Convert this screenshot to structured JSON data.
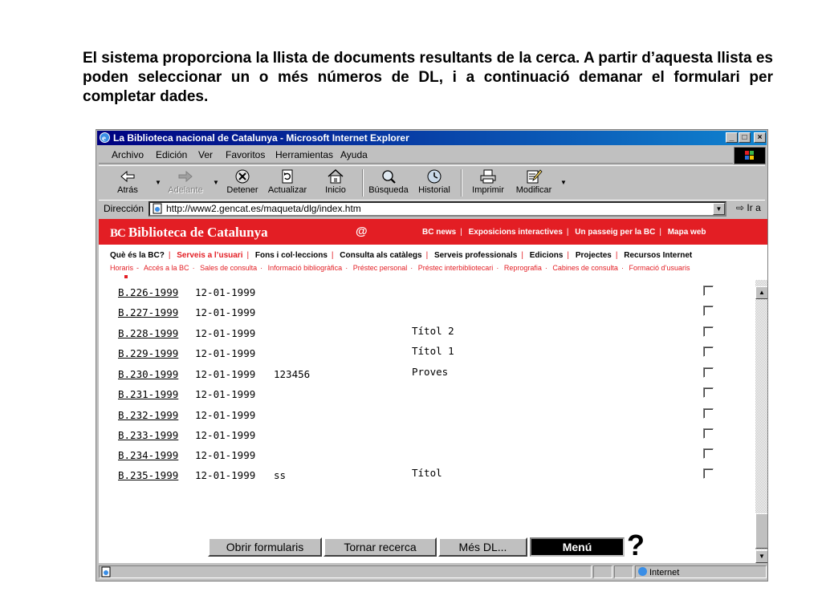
{
  "intro_text": "El sistema proporciona la llista de documents resultants de la cerca. A partir d’aquesta llista es poden seleccionar un o més números de DL, i a continuació demanar el formulari per completar dades.",
  "window": {
    "title": "La Biblioteca nacional de Catalunya - Microsoft Internet Explorer",
    "controls": [
      "_",
      "□",
      "×"
    ]
  },
  "menubar": [
    {
      "label": "Archivo"
    },
    {
      "label": "Edición"
    },
    {
      "label": "Ver"
    },
    {
      "label": "Favoritos"
    },
    {
      "label": "Herramientas"
    },
    {
      "label": "Ayuda"
    }
  ],
  "toolbar": {
    "back": "Atrás",
    "forward": "Adelante",
    "stop": "Detener",
    "refresh": "Actualizar",
    "home": "Inicio",
    "search": "Búsqueda",
    "history": "Historial",
    "print": "Imprimir",
    "edit": "Modificar"
  },
  "address": {
    "label": "Dirección",
    "url": "http://www2.gencat.es/maqueta/dlg/index.htm",
    "go": "Ir a"
  },
  "site": {
    "logo": "Biblioteca de Catalunya",
    "logo_mark": "BC",
    "at_symbol": "@",
    "top_links": [
      "BC news",
      "Exposicions interactives",
      "Un passeig per la BC",
      "Mapa web"
    ],
    "separator": "|",
    "nav": [
      "Què és la BC?",
      "Serveis a l’usuari",
      "Fons i col·leccions",
      "Consulta als catàlegs",
      "Serveis professionals",
      "Edicions",
      "Projectes",
      "Recursos Internet"
    ],
    "nav_active": "Serveis a l’usuari",
    "subnav": [
      "Horaris",
      "Accés a la BC",
      "Sales de consulta",
      "Informació bibliogràfica",
      "Préstec personal",
      "Préstec interbibliotecari",
      "Reprografia",
      "Cabines de consulta",
      "Formació d’usuaris"
    ],
    "subnav_sep_after_first": "-",
    "subnav_sep": "·"
  },
  "results": [
    {
      "code": "B.226-1999",
      "date": "12-01-1999",
      "extra": "",
      "title": ""
    },
    {
      "code": "B.227-1999",
      "date": "12-01-1999",
      "extra": "",
      "title": ""
    },
    {
      "code": "B.228-1999",
      "date": "12-01-1999",
      "extra": "",
      "title": "Títol 2"
    },
    {
      "code": "B.229-1999",
      "date": "12-01-1999",
      "extra": "",
      "title": "Títol 1"
    },
    {
      "code": "B.230-1999",
      "date": "12-01-1999",
      "extra": "123456",
      "title": "Proves"
    },
    {
      "code": "B.231-1999",
      "date": "12-01-1999",
      "extra": "",
      "title": ""
    },
    {
      "code": "B.232-1999",
      "date": "12-01-1999",
      "extra": "",
      "title": ""
    },
    {
      "code": "B.233-1999",
      "date": "12-01-1999",
      "extra": "",
      "title": ""
    },
    {
      "code": "B.234-1999",
      "date": "12-01-1999",
      "extra": "",
      "title": ""
    },
    {
      "code": "B.235-1999",
      "date": "12-01-1999",
      "extra": "ss",
      "title": "Títol"
    }
  ],
  "buttons": {
    "open_forms": "Obrir formularis",
    "back_search": "Tornar recerca",
    "more_dl": "Més DL...",
    "menu": "Menú",
    "help": "?"
  },
  "status": {
    "zone": "Internet"
  }
}
